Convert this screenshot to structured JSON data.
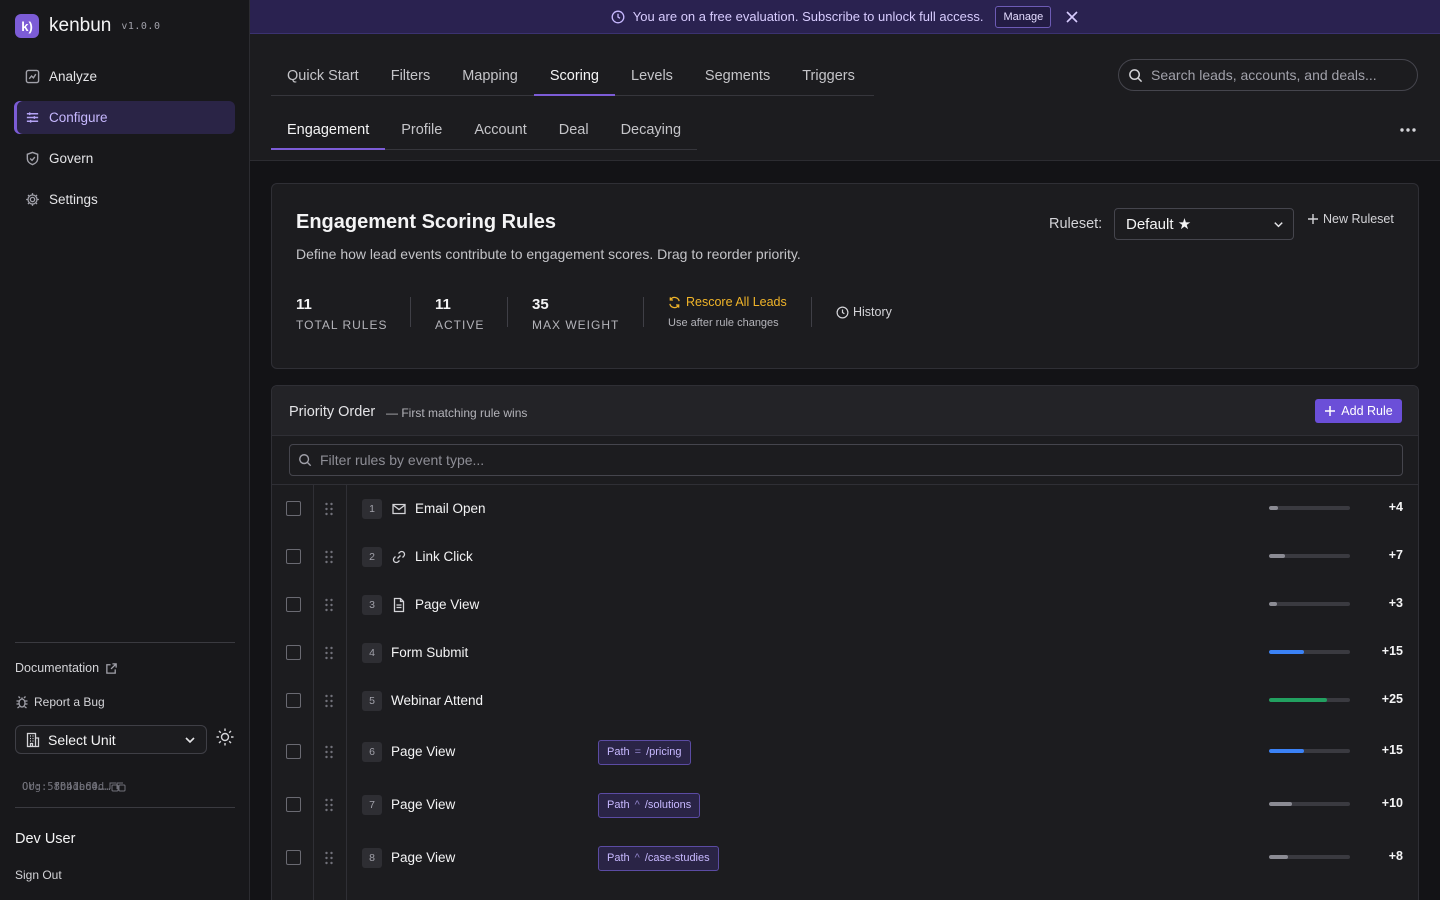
{
  "app": {
    "name": "kenbun",
    "version": "v1.0.0",
    "logo_glyph": "k)"
  },
  "sidebar": {
    "nav": [
      {
        "label": "Analyze",
        "icon": "analyze-icon",
        "active": false
      },
      {
        "label": "Configure",
        "icon": "sliders-icon",
        "active": true
      },
      {
        "label": "Govern",
        "icon": "shield-icon",
        "active": false
      },
      {
        "label": "Settings",
        "icon": "gear-icon",
        "active": false
      }
    ],
    "documentation": "Documentation",
    "report_bug": "Report a Bug",
    "unit_select": "Select Unit",
    "org_id": "Org: 8b4de64d…",
    "ou_id": "OU: 5f0b1bd0…",
    "user_name": "Dev User",
    "sign_out": "Sign Out"
  },
  "banner": {
    "message": "You are on a free evaluation. Subscribe to unlock full access.",
    "manage": "Manage"
  },
  "tabs_primary": [
    {
      "label": "Quick Start",
      "active": false
    },
    {
      "label": "Filters",
      "active": false
    },
    {
      "label": "Mapping",
      "active": false
    },
    {
      "label": "Scoring",
      "active": true
    },
    {
      "label": "Levels",
      "active": false
    },
    {
      "label": "Segments",
      "active": false
    },
    {
      "label": "Triggers",
      "active": false
    }
  ],
  "tabs_secondary": [
    {
      "label": "Engagement",
      "active": true
    },
    {
      "label": "Profile",
      "active": false
    },
    {
      "label": "Account",
      "active": false
    },
    {
      "label": "Deal",
      "active": false
    },
    {
      "label": "Decaying",
      "active": false
    }
  ],
  "search": {
    "placeholder": "Search leads, accounts, and deals..."
  },
  "summary": {
    "title": "Engagement Scoring Rules",
    "description": "Define how lead events contribute to engagement scores. Drag to reorder priority.",
    "ruleset_label": "Ruleset:",
    "ruleset_value": "Default ★",
    "new_ruleset": "New Ruleset",
    "stats": [
      {
        "value": "11",
        "label": "TOTAL RULES"
      },
      {
        "value": "11",
        "label": "ACTIVE"
      },
      {
        "value": "35",
        "label": "MAX WEIGHT"
      }
    ],
    "rescore": "Rescore All Leads",
    "rescore_hint": "Use after rule changes",
    "history": "History"
  },
  "priority": {
    "title": "Priority Order",
    "subtitle": "— First matching rule wins",
    "add_rule": "Add Rule",
    "filter_placeholder": "Filter rules by event type...",
    "rules": [
      {
        "rank": "1",
        "event": "Email Open",
        "icon": "mail-icon",
        "weight": "+4",
        "level": 0.114,
        "color": "#8b8b93",
        "condition": null
      },
      {
        "rank": "2",
        "event": "Link Click",
        "icon": "link-icon",
        "weight": "+7",
        "level": 0.2,
        "color": "#8b8b93",
        "condition": null
      },
      {
        "rank": "3",
        "event": "Page View",
        "icon": "document-icon",
        "weight": "+3",
        "level": 0.086,
        "color": "#8b8b93",
        "condition": null
      },
      {
        "rank": "4",
        "event": "Form Submit",
        "icon": null,
        "weight": "+15",
        "level": 0.43,
        "color": "#3b82f6",
        "condition": null
      },
      {
        "rank": "5",
        "event": "Webinar Attend",
        "icon": null,
        "weight": "+25",
        "level": 0.714,
        "color": "#22a060",
        "condition": null
      },
      {
        "rank": "6",
        "event": "Page View",
        "icon": null,
        "weight": "+15",
        "level": 0.43,
        "color": "#3b82f6",
        "condition": {
          "field": "Path",
          "op": "=",
          "value": "/pricing"
        }
      },
      {
        "rank": "7",
        "event": "Page View",
        "icon": null,
        "weight": "+10",
        "level": 0.286,
        "color": "#8b8b93",
        "condition": {
          "field": "Path",
          "op": "^",
          "value": "/solutions"
        }
      },
      {
        "rank": "8",
        "event": "Page View",
        "icon": null,
        "weight": "+8",
        "level": 0.229,
        "color": "#8b8b93",
        "condition": {
          "field": "Path",
          "op": "^",
          "value": "/case-studies"
        }
      }
    ]
  }
}
